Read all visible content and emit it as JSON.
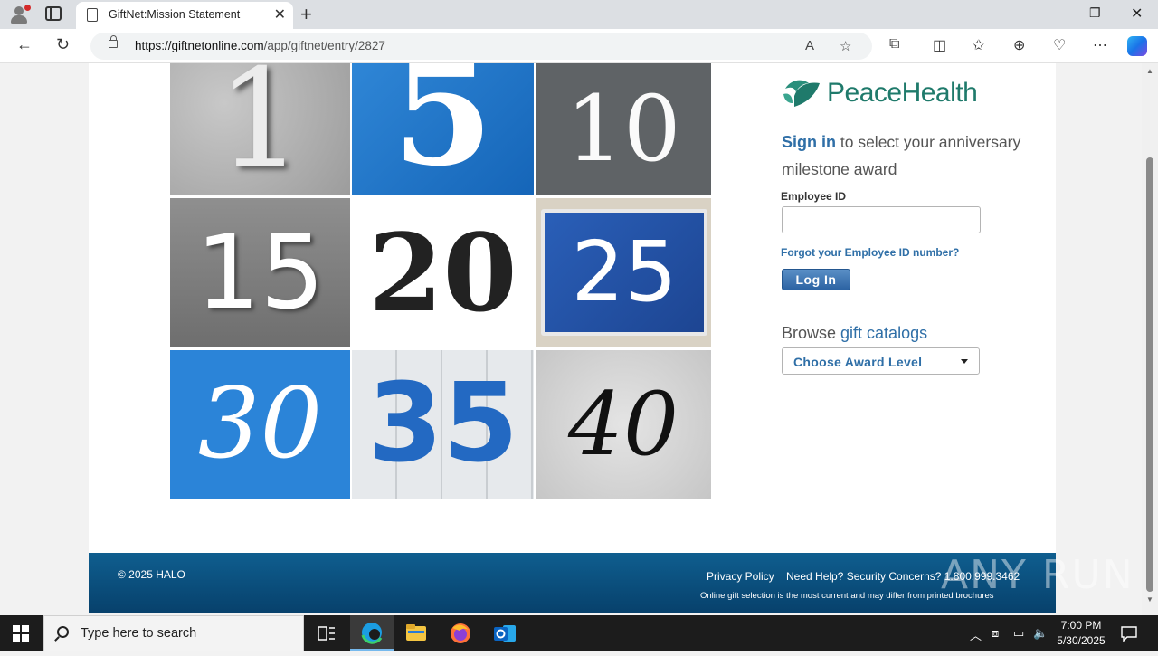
{
  "browser": {
    "tab_title": "GiftNet:Mission Statement",
    "url_host": "https://giftnetonline.com",
    "url_path": "/app/giftnet/entry/2827"
  },
  "tiles": [
    "1",
    "5",
    "10",
    "15",
    "20",
    "25",
    "30",
    "35",
    "40"
  ],
  "brand": {
    "name": "PeaceHealth",
    "color": "#1f7a6b"
  },
  "signin": {
    "link": "Sign in",
    "rest": " to select your anniversary milestone award",
    "employee_label": "Employee ID",
    "employee_value": "",
    "forgot": "Forgot your Employee ID number?",
    "login_button": "Log In"
  },
  "browse": {
    "prefix": "Browse ",
    "link": "gift catalogs",
    "select_value": "Choose Award Level"
  },
  "footer": {
    "copyright": "© 2025 HALO",
    "privacy": "Privacy Policy",
    "help": "Need Help? Security Concerns? 1.800.999.3462",
    "note": "Online gift selection is the most current and may differ from printed brochures",
    "bg_color": "#07416c"
  },
  "taskbar": {
    "search_placeholder": "Type here to search",
    "time": "7:00 PM",
    "date": "5/30/2025"
  },
  "watermark": "ANY RUN",
  "accent_color": "#2f6fa7"
}
